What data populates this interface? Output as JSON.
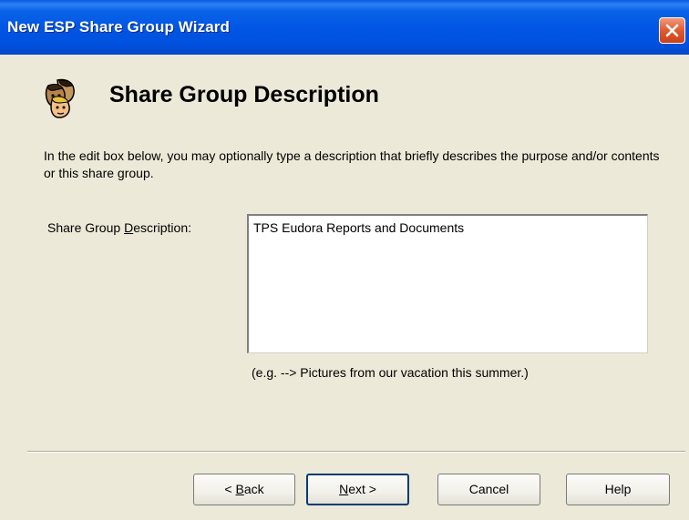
{
  "window": {
    "title": "New ESP Share Group Wizard"
  },
  "header": {
    "title": "Share Group Description",
    "icon": "people-faces-icon"
  },
  "instructions": "In the edit box below, you may optionally type a description that briefly describes the purpose and/or contents or this share group.",
  "description": {
    "label_pre": "Share Group ",
    "label_mnemonic": "D",
    "label_post": "escription:",
    "value": "TPS Eudora Reports and Documents",
    "example": "(e.g. --> Pictures from our vacation this summer.)"
  },
  "buttons": {
    "back_pre": "< ",
    "back_mnemonic": "B",
    "back_post": "ack",
    "next_mnemonic": "N",
    "next_post": "ext >",
    "cancel": "Cancel",
    "help": "Help"
  }
}
